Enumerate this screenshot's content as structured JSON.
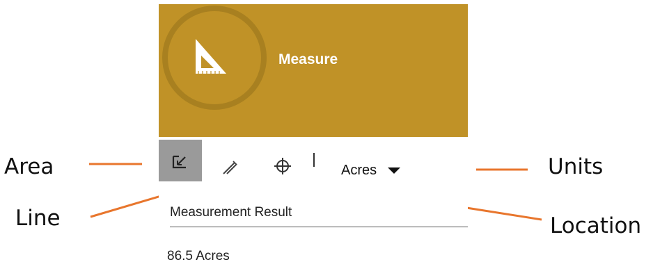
{
  "panel": {
    "title": "Measure",
    "header_color": "#C09227",
    "header_icon": "measure-triangle-icon"
  },
  "toolbar": {
    "tools": [
      {
        "label": "Area",
        "icon": "area-measure-icon",
        "selected": true
      },
      {
        "label": "Line",
        "icon": "line-measure-icon",
        "selected": false
      },
      {
        "label": "Location",
        "icon": "location-crosshair-icon",
        "selected": false
      }
    ],
    "units_value": "Acres",
    "units_icon": "caret-down-icon"
  },
  "result": {
    "heading": "Measurement Result",
    "value": "86.5 Acres"
  },
  "annotations": {
    "area": "Area",
    "line": "Line",
    "units": "Units",
    "location": "Location",
    "callout_color": "#E8762D"
  }
}
